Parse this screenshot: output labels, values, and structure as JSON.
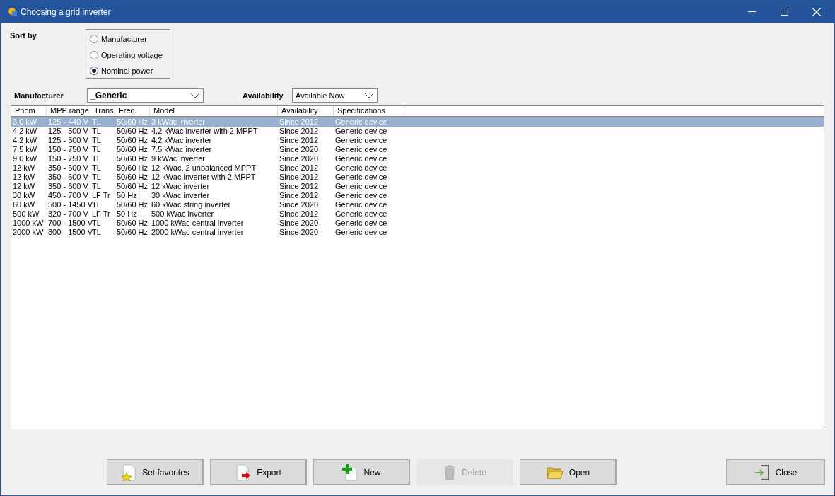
{
  "window": {
    "title": "Choosing a grid inverter"
  },
  "sort_by": {
    "label": "Sort by",
    "options": [
      {
        "label": "Manufacturer",
        "selected": false
      },
      {
        "label": "Operating voltage",
        "selected": false
      },
      {
        "label": "Nominal power",
        "selected": true
      }
    ]
  },
  "manufacturer": {
    "label": "Manufacturer",
    "value": "_Generic"
  },
  "availability": {
    "label": "Availability",
    "value": "Available Now"
  },
  "table": {
    "columns": [
      "Pnom",
      "MPP range",
      "Trans",
      "Freq.",
      "Model",
      "Availability",
      "Specifications"
    ],
    "rows": [
      {
        "selected": true,
        "cells": [
          "3.0 kW",
          "125 - 440 V",
          "TL",
          "50/60 Hz",
          "3 kWac inverter",
          "Since 2012",
          "Generic device"
        ]
      },
      {
        "selected": false,
        "cells": [
          "4.2 kW",
          "125 - 500 V",
          "TL",
          "50/60 Hz",
          "4.2 kWac inverter with 2 MPPT",
          "Since 2012",
          "Generic device"
        ]
      },
      {
        "selected": false,
        "cells": [
          "4.2 kW",
          "125 - 500 V",
          "TL",
          "50/60 Hz",
          "4.2 kWac inverter",
          "Since 2012",
          "Generic device"
        ]
      },
      {
        "selected": false,
        "cells": [
          "7.5 kW",
          "150 - 750 V",
          "TL",
          "50/60 Hz",
          "7.5 kWac inverter",
          "Since 2020",
          "Generic device"
        ]
      },
      {
        "selected": false,
        "cells": [
          "9.0 kW",
          "150 - 750 V",
          "TL",
          "50/60 Hz",
          "9 kWac inverter",
          "Since 2020",
          "Generic device"
        ]
      },
      {
        "selected": false,
        "cells": [
          "12 kW",
          "350 - 600 V",
          "TL",
          "50/60 Hz",
          "12 kWac, 2 unbalanced MPPT",
          "Since 2012",
          "Generic device"
        ]
      },
      {
        "selected": false,
        "cells": [
          "12 kW",
          "350 - 600 V",
          "TL",
          "50/60 Hz",
          "12 kWac inverter with 2 MPPT",
          "Since 2012",
          "Generic device"
        ]
      },
      {
        "selected": false,
        "cells": [
          "12 kW",
          "350 - 600 V",
          "TL",
          "50/60 Hz",
          "12 kWac inverter",
          "Since 2012",
          "Generic device"
        ]
      },
      {
        "selected": false,
        "cells": [
          "30 kW",
          "450 - 700 V",
          "LF Tr",
          "50 Hz",
          "30 kWac inverter",
          "Since 2012",
          "Generic device"
        ]
      },
      {
        "selected": false,
        "cells": [
          "60 kW",
          "500 - 1450 V",
          "TL",
          "50/60 Hz",
          "60 kWac string inverter",
          "Since 2020",
          "Generic device"
        ]
      },
      {
        "selected": false,
        "cells": [
          "500 kW",
          "320 - 700 V",
          "LF Tr",
          "50 Hz",
          "500 kWac inverter",
          "Since 2012",
          "Generic device"
        ]
      },
      {
        "selected": false,
        "cells": [
          "1000 kW",
          "700 - 1500 V",
          "TL",
          "50/60 Hz",
          "1000 kWac central inverter",
          "Since 2020",
          "Generic device"
        ]
      },
      {
        "selected": false,
        "cells": [
          "2000 kW",
          "800 - 1500 V",
          "TL",
          "50/60 Hz",
          "2000 kWac central inverter",
          "Since 2020",
          "Generic device"
        ]
      }
    ]
  },
  "buttons": [
    {
      "kind": "favorites",
      "label": "Set favorites",
      "disabled": false
    },
    {
      "kind": "export",
      "label": "Export",
      "disabled": false
    },
    {
      "kind": "new",
      "label": "New",
      "disabled": false
    },
    {
      "kind": "delete",
      "label": "Delete",
      "disabled": true
    },
    {
      "kind": "open",
      "label": "Open",
      "disabled": false
    }
  ],
  "close_button": {
    "kind": "close",
    "label": "Close"
  }
}
